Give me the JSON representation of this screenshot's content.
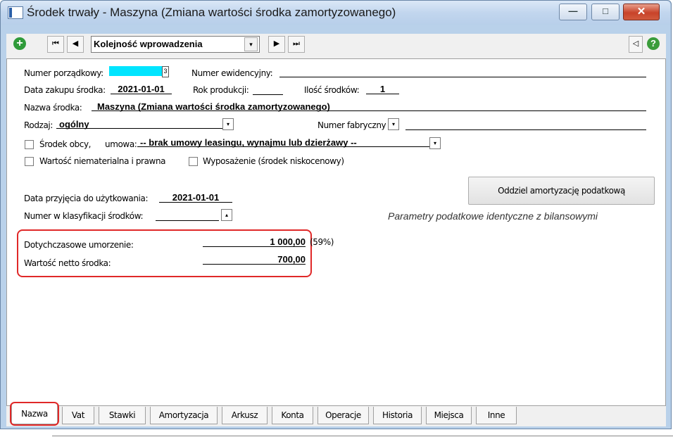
{
  "window": {
    "title": "Środek trwały - Maszyna (Zmiana wartości środka zamortyzowanego)",
    "min_glyph": "—",
    "max_glyph": "□",
    "close_glyph": "✕"
  },
  "toolbar": {
    "add_glyph": "+",
    "first_glyph": "⏮",
    "prev_glyph": "◀",
    "order_select": "Kolejność wprowadzenia",
    "next_glyph": "▶",
    "last_glyph": "⏭",
    "side_glyph": "◁",
    "help_glyph": "?"
  },
  "form": {
    "numer_porzadkowy_label": "Numer porządkowy:",
    "numer_porzadkowy_value": "",
    "numer_ewidencyjny_label": "Numer ewidencyjny:",
    "numer_ewidencyjny_value": "",
    "data_zakupu_label": "Data zakupu środka:",
    "data_zakupu_value": "2021-01-01",
    "rok_produkcji_label": "Rok produkcji:",
    "rok_produkcji_value": "",
    "ilosc_srodkow_label": "Ilość środków:",
    "ilosc_srodkow_value": "1",
    "nazwa_label": "Nazwa środka:",
    "nazwa_value": "Maszyna (Zmiana wartości środka zamortyzowanego)",
    "rodzaj_label": "Rodzaj:",
    "rodzaj_value": "ogólny",
    "numer_fabryczny_label": "Numer fabryczny",
    "numer_fabryczny_value": "",
    "srodek_obcy_label": "Środek obcy,",
    "umowa_label": "umowa:",
    "umowa_value": "-- brak umowy leasingu, wynajmu lub dzierżawy --",
    "wartosc_niematerialna_label": "Wartość niematerialna i prawna",
    "wyposazenie_label": "Wyposażenie (środek niskocenowy)",
    "data_przyjecia_label": "Data przyjęcia do użytkowania:",
    "data_przyjecia_value": "2021-01-01",
    "klasyfikacja_label": "Numer w klasyfikacji środków:",
    "klasyfikacja_value": "",
    "oddziel_button": "Oddziel amortyzację podatkową",
    "parametry_text": "Parametry podatkowe identyczne z bilansowymi",
    "umorzenie_label": "Dotychczasowe umorzenie:",
    "umorzenie_value": "1 000,00",
    "umorzenie_pct": "(59%)",
    "netto_label": "Wartość netto środka:",
    "netto_value": "700,00"
  },
  "tabs": [
    "Nazwa",
    "Vat",
    "Stawki",
    "Amortyzacja",
    "Arkusz",
    "Konta",
    "Operacje",
    "Historia",
    "Miejsca",
    "Inne"
  ],
  "colors": {
    "highlight_red": "#e02828",
    "field_cyan": "#00e5ff"
  }
}
